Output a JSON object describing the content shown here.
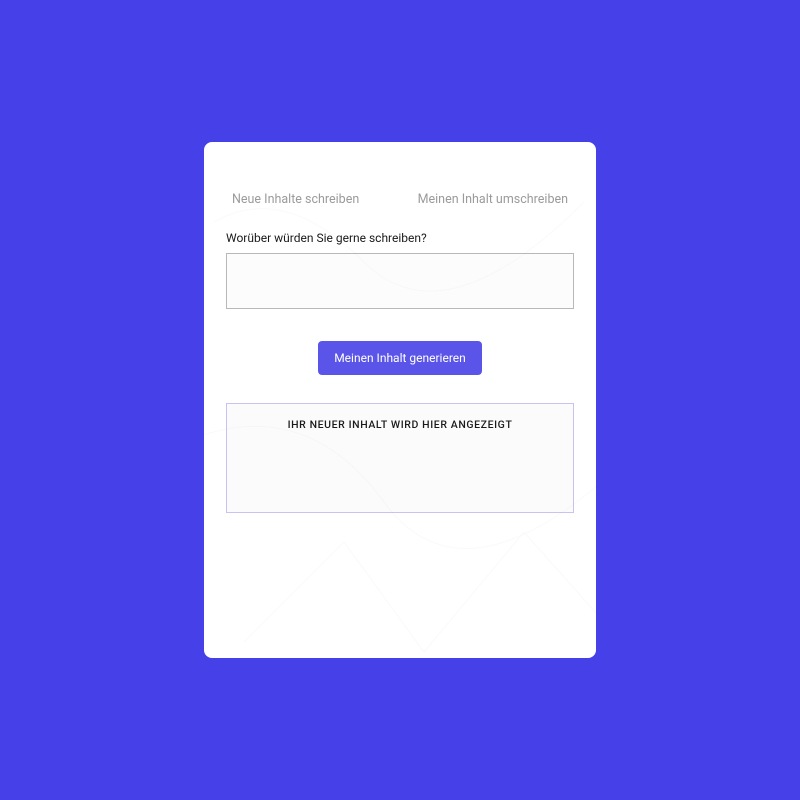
{
  "tabs": {
    "write_new": "Neue Inhalte schreiben",
    "rewrite": "Meinen Inhalt umschreiben"
  },
  "prompt": {
    "label": "Worüber würden Sie gerne schreiben?"
  },
  "actions": {
    "generate_label": "Meinen Inhalt generieren"
  },
  "output": {
    "placeholder": "IHR NEUER INHALT WIRD HIER ANGEZEIGT"
  },
  "colors": {
    "page_bg": "#4640E8",
    "button_bg": "#5a55e8"
  }
}
